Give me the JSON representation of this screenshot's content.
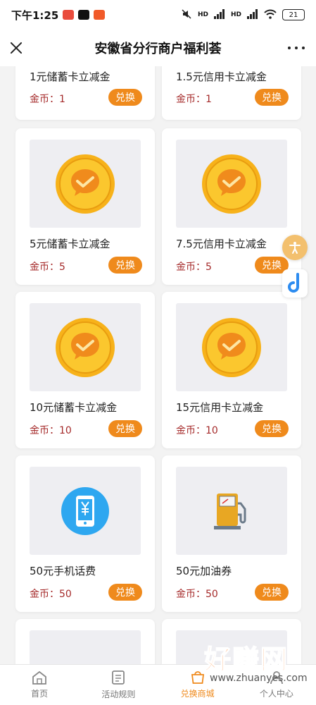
{
  "status_bar": {
    "time": "下午1:25",
    "network_1": "HD",
    "network_2": "HD",
    "battery": "21"
  },
  "title_bar": {
    "title": "安徽省分行商户福利荟"
  },
  "currency_label": "金币：",
  "exchange_label": "兑换",
  "products": [
    {
      "name": "1元储蓄卡立减金",
      "price": "1",
      "icon": "coin-icon"
    },
    {
      "name": "1.5元信用卡立减金",
      "price": "1",
      "icon": "coin-icon"
    },
    {
      "name": "5元储蓄卡立减金",
      "price": "5",
      "icon": "coin-icon"
    },
    {
      "name": "7.5元信用卡立减金",
      "price": "5",
      "icon": "coin-icon"
    },
    {
      "name": "10元储蓄卡立减金",
      "price": "10",
      "icon": "coin-icon"
    },
    {
      "name": "15元信用卡立减金",
      "price": "10",
      "icon": "coin-icon"
    },
    {
      "name": "50元手机话费",
      "price": "50",
      "icon": "phone-yuan-icon"
    },
    {
      "name": "50元加油券",
      "price": "50",
      "icon": "fuel-pump-icon"
    }
  ],
  "bottom_nav": [
    {
      "label": "首页",
      "icon": "home-icon",
      "active": false
    },
    {
      "label": "活动规则",
      "icon": "rules-icon",
      "active": false
    },
    {
      "label": "兑换商城",
      "icon": "mall-icon",
      "active": true
    },
    {
      "label": "个人中心",
      "icon": "user-icon",
      "active": false
    }
  ],
  "watermark": {
    "brand": "好赚网",
    "site": "www.zhuanyes.com"
  },
  "colors": {
    "accent": "#ef8a1c",
    "price_text": "#a52a2a",
    "card_bg": "#ffffff",
    "page_bg": "#f3f3f3"
  }
}
